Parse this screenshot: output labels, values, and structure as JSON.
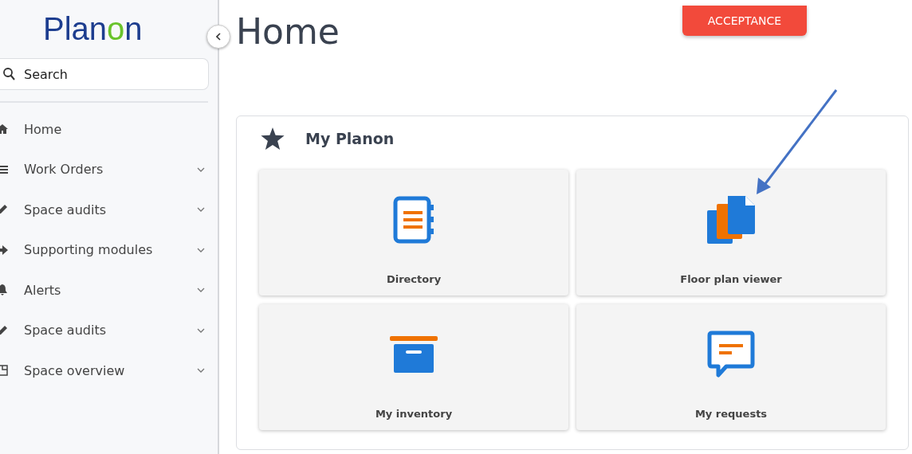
{
  "sidebar": {
    "logo": "Planon",
    "search": {
      "placeholder": "Search"
    },
    "items": [
      {
        "label": "Home",
        "expandable": false
      },
      {
        "label": "Work Orders",
        "expandable": true
      },
      {
        "label": "Space audits",
        "expandable": true
      },
      {
        "label": "Supporting modules",
        "expandable": true
      },
      {
        "label": "Alerts",
        "expandable": true
      },
      {
        "label": "Space audits",
        "expandable": true
      },
      {
        "label": "Space overview",
        "expandable": true
      }
    ]
  },
  "page": {
    "title": "Home",
    "environment_badge": "ACCEPTANCE"
  },
  "panel": {
    "title": "My Planon",
    "tiles": [
      {
        "label": "Directory"
      },
      {
        "label": "Floor plan viewer"
      },
      {
        "label": "My inventory"
      },
      {
        "label": "My requests"
      }
    ]
  }
}
